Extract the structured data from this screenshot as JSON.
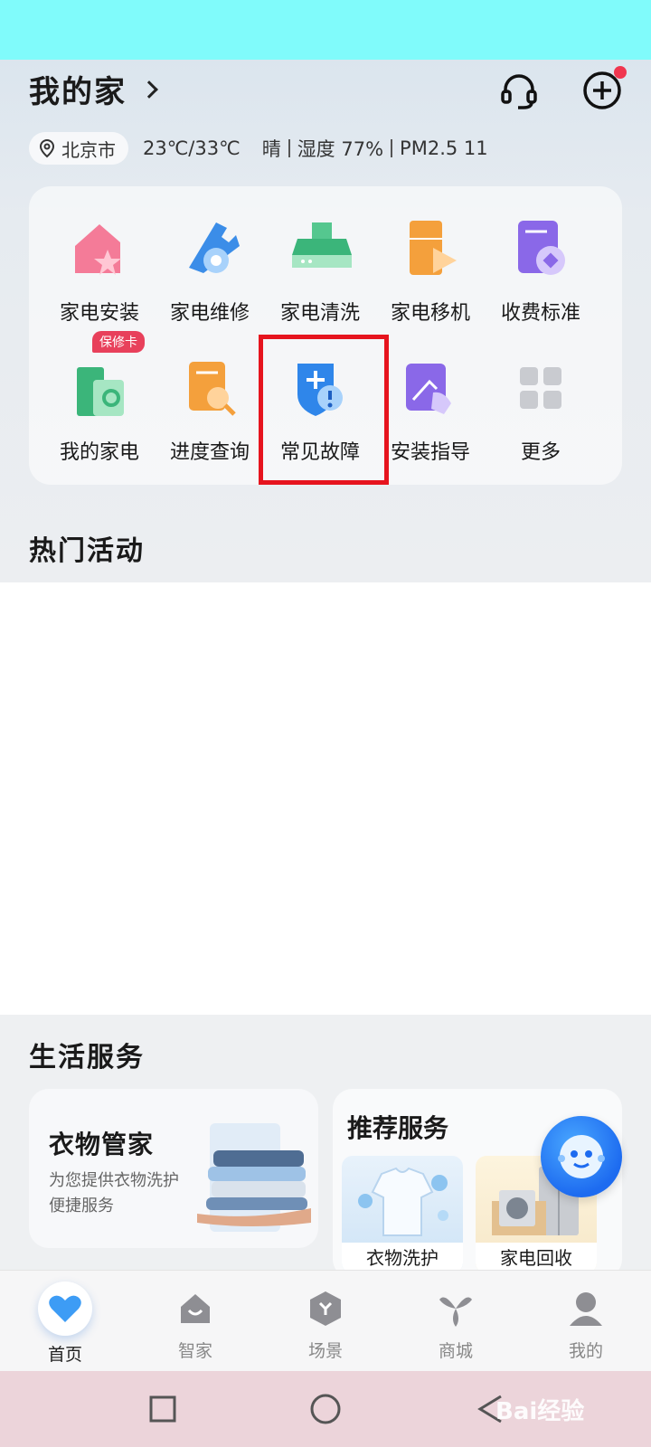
{
  "header": {
    "title": "我的家",
    "location": "北京市",
    "temperature": "23℃/33℃",
    "weather": "晴",
    "humidity": "湿度 77%",
    "pm25": "PM2.5 11"
  },
  "services": [
    {
      "label": "家电安装",
      "icon": "house-star-icon"
    },
    {
      "label": "家电维修",
      "icon": "wrench-icon"
    },
    {
      "label": "家电清洗",
      "icon": "range-hood-icon"
    },
    {
      "label": "家电移机",
      "icon": "fridge-move-icon"
    },
    {
      "label": "收费标准",
      "icon": "price-doc-icon"
    },
    {
      "label": "我的家电",
      "icon": "my-appliance-icon",
      "tag": "保修卡"
    },
    {
      "label": "进度查询",
      "icon": "progress-query-icon"
    },
    {
      "label": "常见故障",
      "icon": "shield-fault-icon"
    },
    {
      "label": "安装指导",
      "icon": "install-guide-icon"
    },
    {
      "label": "更多",
      "icon": "more-grid-icon"
    }
  ],
  "hot_activities": {
    "title": "热门活动"
  },
  "life_services": {
    "title": "生活服务",
    "clothes": {
      "title": "衣物管家",
      "desc": "为您提供衣物洗护便捷服务"
    },
    "recommend": {
      "title": "推荐服务",
      "items": [
        "衣物洗护",
        "家电回收"
      ]
    }
  },
  "tabs": [
    {
      "label": "首页",
      "icon": "heart-icon",
      "active": true
    },
    {
      "label": "智家",
      "icon": "smart-home-icon"
    },
    {
      "label": "场景",
      "icon": "scene-icon"
    },
    {
      "label": "商城",
      "icon": "mall-icon"
    },
    {
      "label": "我的",
      "icon": "profile-icon"
    }
  ],
  "watermark": "Bai经验",
  "colors": {
    "status_bar": "#80fbfb",
    "accent": "#1d6bf0",
    "highlight": "#e6141e",
    "nav_bar": "#ecd4da"
  }
}
